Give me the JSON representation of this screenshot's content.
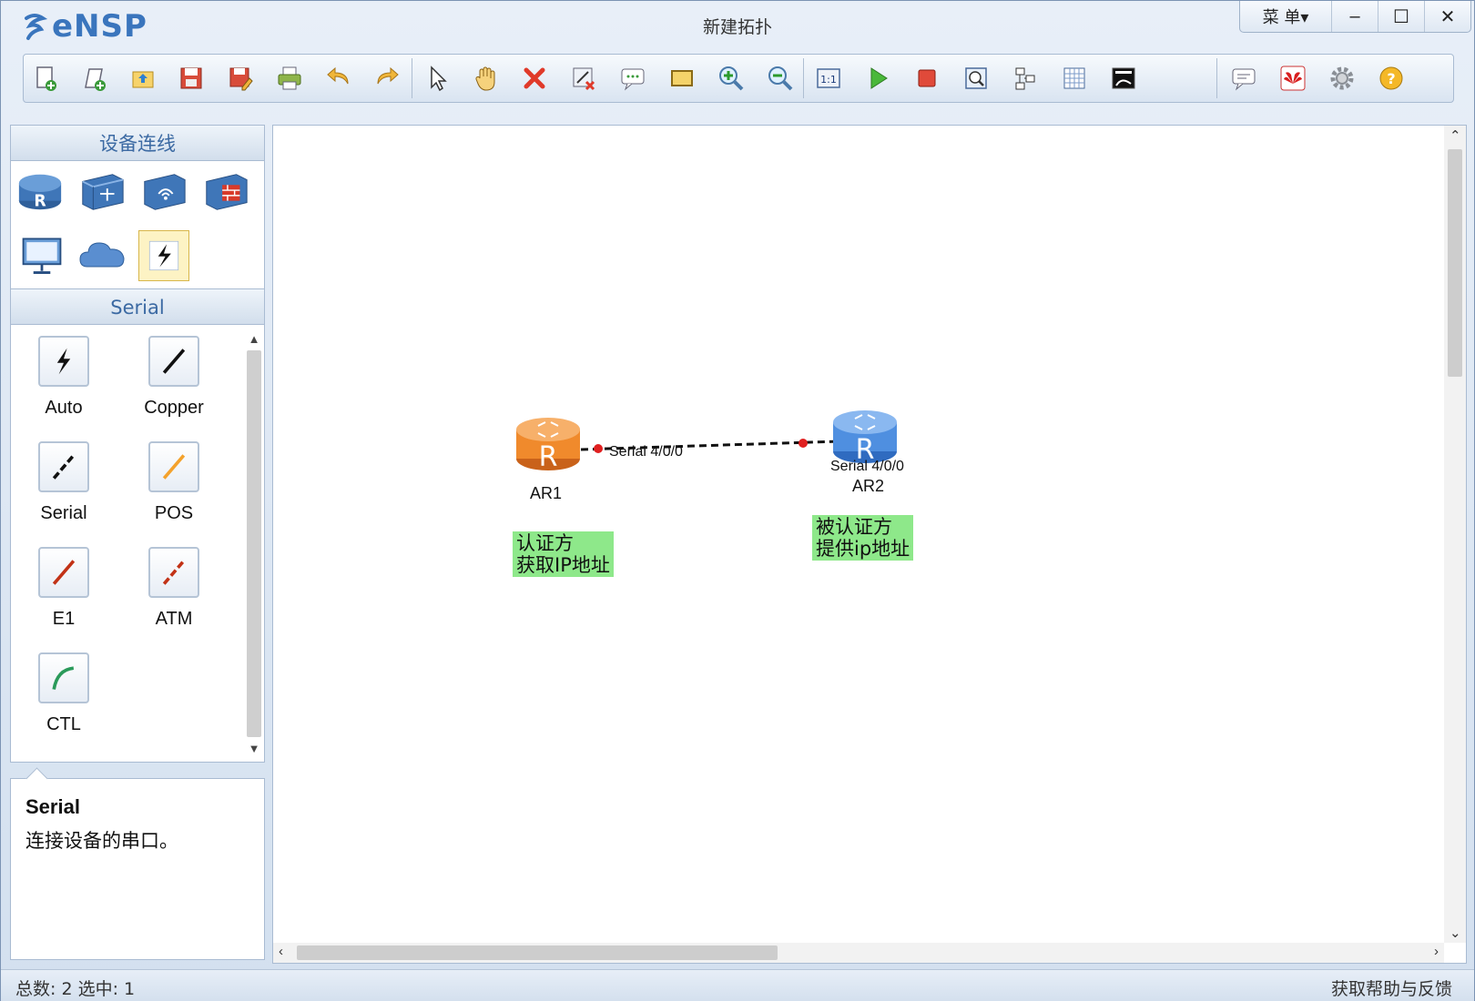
{
  "app": {
    "name": "eNSP",
    "window_title": "新建拓扑"
  },
  "window_controls": {
    "menu_label": "菜 单▾",
    "minimize": "–",
    "maximize": "☐",
    "close": "✕"
  },
  "toolbar": {
    "buttons": [
      "new-topology-icon",
      "new-lab-icon",
      "open-icon",
      "save-icon",
      "save-as-icon",
      "print-icon",
      "undo-icon",
      "redo-icon",
      "select-pointer-icon",
      "hand-pan-icon",
      "delete-icon",
      "delete-connection-icon",
      "add-text-icon",
      "add-shape-icon",
      "zoom-in-icon",
      "zoom-out-icon",
      "reset-zoom-icon",
      "start-device-icon",
      "stop-device-icon",
      "capture-icon",
      "show-interfaces-icon",
      "show-grid-icon",
      "topology-snapshot-icon",
      "message-icon",
      "huawei-icon",
      "settings-icon",
      "help-icon"
    ]
  },
  "left_panel": {
    "devices_header": "设备连线",
    "devices": [
      "router-icon",
      "switch-icon",
      "wireless-icon",
      "firewall-icon",
      "pc-icon",
      "cloud-icon",
      "connection-icon"
    ],
    "selected_category": "Serial",
    "cables": [
      {
        "label": "Auto",
        "icon": "auto-cable-icon"
      },
      {
        "label": "Copper",
        "icon": "copper-cable-icon"
      },
      {
        "label": "Serial",
        "icon": "serial-cable-icon"
      },
      {
        "label": "POS",
        "icon": "pos-cable-icon"
      },
      {
        "label": "E1",
        "icon": "e1-cable-icon"
      },
      {
        "label": "ATM",
        "icon": "atm-cable-icon"
      },
      {
        "label": "CTL",
        "icon": "ctl-cable-icon"
      }
    ],
    "description": {
      "title": "Serial",
      "text": "连接设备的串口。"
    }
  },
  "canvas": {
    "nodes": [
      {
        "name": "AR1",
        "color": "#f08a2c"
      },
      {
        "name": "AR2",
        "color": "#4f8fe0"
      }
    ],
    "link": {
      "from_port": "Serial 4/0/0",
      "to_port": "Serial 4/0/0",
      "style": "dashed",
      "endpoint_color": "#e02020"
    },
    "notes": [
      {
        "lines": [
          "认证方",
          "获取IP地址"
        ],
        "color": "#8ee88a"
      },
      {
        "lines": [
          "被认证方",
          "提供ip地址"
        ],
        "color": "#8ee88a"
      }
    ]
  },
  "status": {
    "left": "总数: 2 选中: 1",
    "right": "获取帮助与反馈"
  }
}
